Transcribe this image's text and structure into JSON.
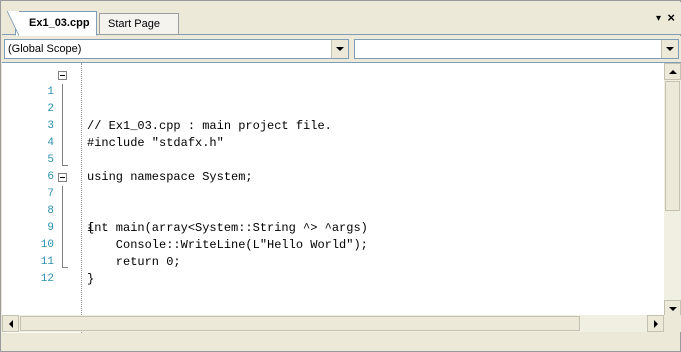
{
  "tabs": {
    "active_label": "Ex1_03.cpp",
    "inactive_label": "Start Page",
    "menu_glyph": "▾",
    "close_glyph": "×"
  },
  "navbar": {
    "scope_value": "(Global Scope)",
    "member_value": ""
  },
  "editor": {
    "lines": [
      {
        "num": "1",
        "code": "// Ex1_03.cpp : main project file."
      },
      {
        "num": "2",
        "code": ""
      },
      {
        "num": "3",
        "code": "#include \"stdafx.h\""
      },
      {
        "num": "4",
        "code": ""
      },
      {
        "num": "5",
        "code": "using namespace System;"
      },
      {
        "num": "6",
        "code": ""
      },
      {
        "num": "7",
        "code": "int main(array<System::String ^> ^args)"
      },
      {
        "num": "8",
        "code": "{"
      },
      {
        "num": "9",
        "code": "    Console::WriteLine(L\"Hello World\");"
      },
      {
        "num": "10",
        "code": "    return 0;"
      },
      {
        "num": "11",
        "code": "}"
      },
      {
        "num": "12",
        "code": ""
      }
    ]
  },
  "icons": {
    "fold": "collapse-minus-icon",
    "dropdown": "chevron-down-icon"
  },
  "colors": {
    "line_numbers": "#2b91af",
    "border": "#7f9db9",
    "chrome": "#ece9d8"
  }
}
